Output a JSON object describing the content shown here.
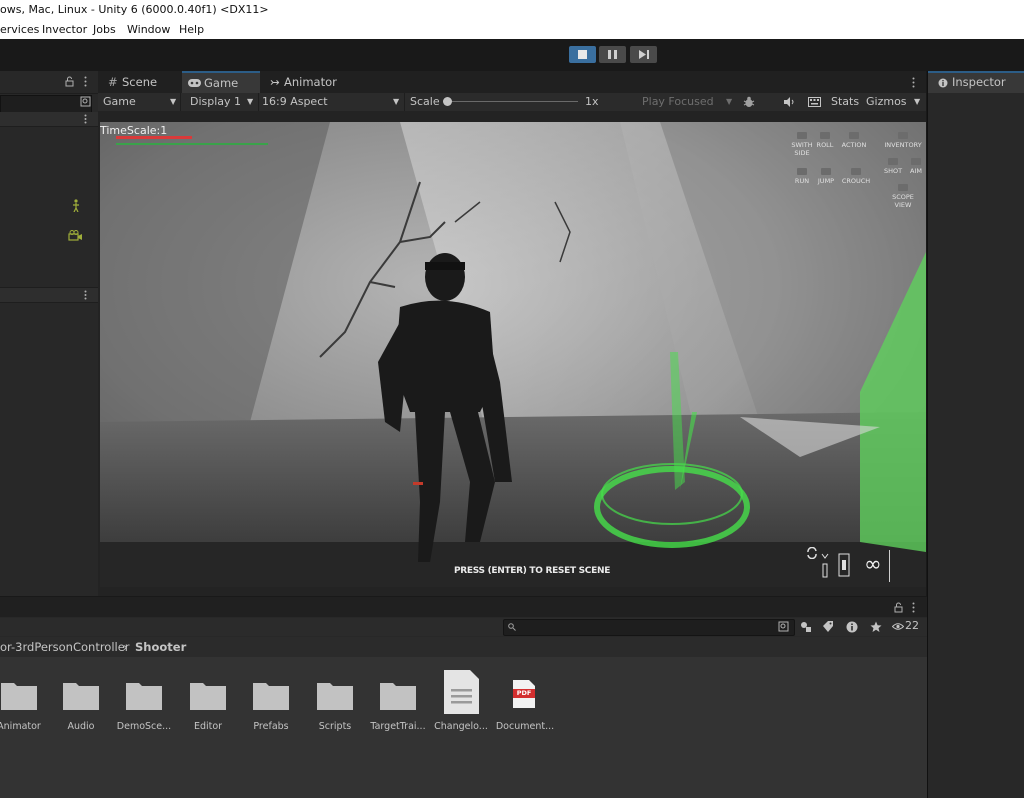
{
  "window": {
    "title": "ows, Mac, Linux - Unity 6 (6000.0.40f1) <DX11>"
  },
  "menu": [
    "ervices",
    "Invector",
    "Jobs",
    "Window",
    "Help"
  ],
  "tabs": {
    "scene": "Scene",
    "game": "Game",
    "animator": "Animator",
    "inspector": "Inspector"
  },
  "game_toolbar": {
    "mode": "Game",
    "display": "Display 1",
    "aspect": "16:9 Aspect",
    "scale_label": "Scale",
    "scale_value": "1x",
    "play_mode": "Play Focused",
    "stats": "Stats",
    "gizmos": "Gizmos"
  },
  "game_view": {
    "timescale": "TimeScale:1",
    "reset_hint": "PRESS (ENTER) TO RESET SCENE",
    "ammo": "∞",
    "hud": {
      "switch_side": "SWITH SIDE",
      "roll": "ROLL",
      "action": "ACTION",
      "inventory": "INVENTORY",
      "run": "RUN",
      "jump": "JUMP",
      "crouch": "CROUCH",
      "shot": "SHOT",
      "aim": "AIM",
      "scope_view": "SCOPE VIEW"
    }
  },
  "project": {
    "breadcrumb_parent": "or-3rdPersonController",
    "breadcrumb_current": "Shooter",
    "visible_count": "22",
    "assets": [
      {
        "label": "Animator",
        "type": "folder"
      },
      {
        "label": "Audio",
        "type": "folder"
      },
      {
        "label": "DemoSce...",
        "type": "folder"
      },
      {
        "label": "Editor",
        "type": "folder"
      },
      {
        "label": "Prefabs",
        "type": "folder"
      },
      {
        "label": "Scripts",
        "type": "folder"
      },
      {
        "label": "TargetTrai...",
        "type": "folder"
      },
      {
        "label": "Changelo...",
        "type": "text-file"
      },
      {
        "label": "Document...",
        "type": "pdf"
      }
    ],
    "pdf_badge": "PDF"
  },
  "colors": {
    "accent": "#2c5d87",
    "play_active": "#3a6f9f",
    "health_bar": "#d93a3a",
    "stamina_bar": "#3aa24a",
    "hud_green": "#46e04a"
  }
}
